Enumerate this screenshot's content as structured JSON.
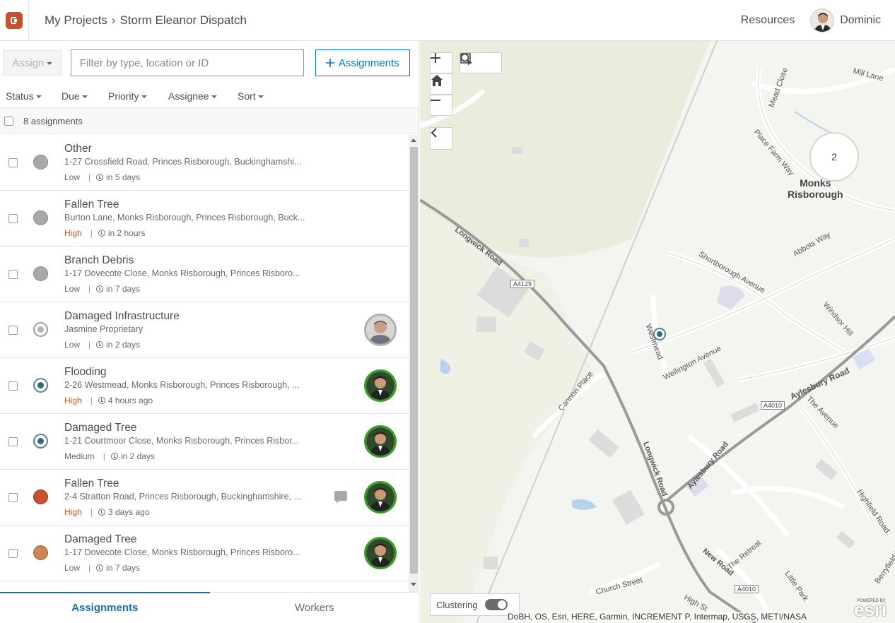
{
  "header": {
    "app_icon": "workforce-logo-icon",
    "breadcrumb": [
      "My Projects",
      "Storm Eleanor Dispatch"
    ],
    "breadcrumb_sep": "›",
    "resources_label": "Resources",
    "user_name": "Dominic"
  },
  "toolbar": {
    "assign_label": "Assign",
    "search_placeholder": "Filter by type, location or ID",
    "add_assignments_label": "Assignments"
  },
  "filters": [
    "Status",
    "Due",
    "Priority",
    "Assignee",
    "Sort"
  ],
  "list": {
    "count_label": "8 assignments",
    "rows": [
      {
        "title": "Other",
        "address": "1-27 Crossfield Road, Princes Risborough, Buckinghamshi...",
        "priority": "Low",
        "due": "in 5 days",
        "status": "unassigned"
      },
      {
        "title": "Fallen Tree",
        "address": "Burton Lane, Monks Risborough, Princes Risborough, Buck...",
        "priority": "High",
        "due": "in 2 hours",
        "status": "unassigned"
      },
      {
        "title": "Branch Debris",
        "address": "1-17 Dovecote Close, Monks Risborough, Princes Risboro...",
        "priority": "Low",
        "due": "in 7 days",
        "status": "unassigned"
      },
      {
        "title": "Damaged Infrastructure",
        "address": "Jasmine Proprietary",
        "priority": "Low",
        "due": "in 2 days",
        "status": "assigned"
      },
      {
        "title": "Flooding",
        "address": "2-26 Westmead, Monks Risborough, Princes Risborough, ...",
        "priority": "High",
        "due": "4 hours ago",
        "status": "in-progress"
      },
      {
        "title": "Damaged Tree",
        "address": "1-21 Courtmoor Close, Monks Risborough, Princes Risbor...",
        "priority": "Medium",
        "due": "in 2 days",
        "status": "in-progress"
      },
      {
        "title": "Fallen Tree",
        "address": "2-4 Stratton Road, Princes Risborough, Buckinghamshire, ...",
        "priority": "High",
        "due": "3 days ago",
        "status": "declined"
      },
      {
        "title": "Damaged Tree",
        "address": "1-17 Dovecote Close, Monks Risborough, Princes Risboro...",
        "priority": "Low",
        "due": "in 7 days",
        "status": "paused"
      }
    ]
  },
  "tabs": {
    "assignments": "Assignments",
    "workers": "Workers"
  },
  "map": {
    "cluster_count": "2",
    "place_name": "Monks Risborough",
    "place_line1": "Monks",
    "place_line2": "Risborough",
    "clustering_label": "Clustering",
    "attribution": "DoBH, OS, Esri, HERE, Garmin, INCREMENT P, Intermap, USGS, METI/NASA",
    "esri_label": "esri",
    "powered_by": "POWERED BY",
    "streets": {
      "longwick1": "Longwick Road",
      "longwick2": "Longwick Road",
      "aylesbury1": "Aylesbury Road",
      "aylesbury2": "Aylesbury Road",
      "westmead": "Westmead",
      "wellington": "Wellington Avenue",
      "shortborough": "Shortborough Avenue",
      "abbots": "Abbots Way",
      "windsor": "Windsor Hill",
      "placefarm": "Place Farm Way",
      "mill": "Mill Lane",
      "mead": "Mead Close",
      "cannon": "Cannon Place",
      "avenue": "The Avenue",
      "highfield": "Highfield Road",
      "berryfield": "Berryfield Road",
      "retreat": "The Retreat",
      "littlepark": "Little Park",
      "church": "Church Street",
      "newroad": "New Road",
      "high": "High St",
      "a4129": "A4129",
      "a4010a": "A4010",
      "a4010b": "A4010"
    }
  },
  "colors": {
    "accent": "#0079c1",
    "high_priority": "#c0552c",
    "assignee_ring": "#35a024"
  }
}
